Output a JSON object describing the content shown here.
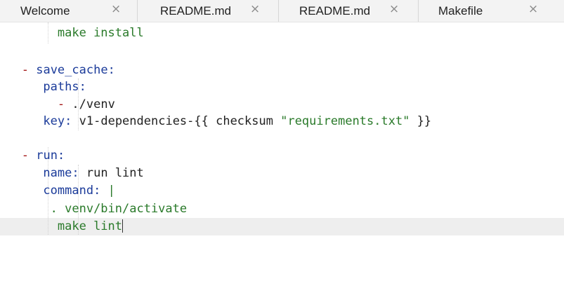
{
  "tabs": [
    {
      "label": "Welcome",
      "close": "×"
    },
    {
      "label": "README.md",
      "close": "×"
    },
    {
      "label": "README.md",
      "close": "×"
    },
    {
      "label": "Makefile",
      "close": "×"
    }
  ],
  "editor": {
    "lines": [
      {
        "indent": "        ",
        "text": "make install"
      },
      {
        "indent": "",
        "text": ""
      },
      {
        "indent": "   ",
        "dash": "-",
        "key": "save_cache",
        "colon": ":"
      },
      {
        "indent": "      ",
        "key": "paths",
        "colon": ":"
      },
      {
        "indent": "        ",
        "dash": "-",
        "value": "./venv"
      },
      {
        "indent": "      ",
        "key": "key",
        "colon": ":",
        "value_pre": "v1-dependencies-{{ checksum ",
        "value_str": "\"requirements.txt\"",
        "value_post": " }}"
      },
      {
        "indent": "",
        "text": ""
      },
      {
        "indent": "   ",
        "dash": "-",
        "key": "run",
        "colon": ":"
      },
      {
        "indent": "      ",
        "key": "name",
        "colon": ":",
        "value": "run lint"
      },
      {
        "indent": "      ",
        "key": "command",
        "colon": ":",
        "value": "|"
      },
      {
        "indent": "       ",
        "text": ". venv/bin/activate"
      },
      {
        "indent": "        ",
        "text": "make lint"
      }
    ]
  },
  "colors": {
    "key": "#1b3b9a",
    "dash": "#a31515",
    "string": "#2a7a2a",
    "text": "#222222",
    "current_line": "#eeeeee",
    "tabbar": "#f3f3f3"
  }
}
